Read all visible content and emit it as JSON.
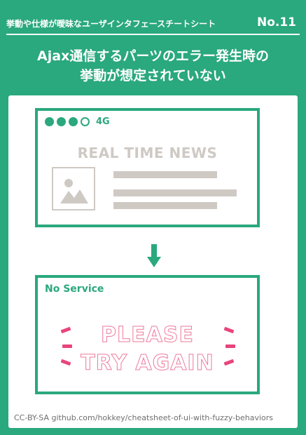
{
  "header": {
    "series": "挙動や仕様が曖昧なユーザインタフェースチートシート",
    "number": "No.11"
  },
  "title": {
    "line1": "Ajax通信するパーツのエラー発生時の",
    "line2": "挙動が想定されていない"
  },
  "before_panel": {
    "signal_bars_filled": 3,
    "signal_bars_total": 4,
    "network": "4G",
    "news_title": "REAL TIME NEWS",
    "thumbnail_icon": "image-placeholder-icon"
  },
  "arrow_icon": "arrow-down-icon",
  "after_panel": {
    "status": "No Service",
    "message_line1": "PLEASE",
    "message_line2": "TRY AGAIN"
  },
  "credit": "CC-BY-SA github.com/hokkey/cheatsheet-of-ui-with-fuzzy-behaviors",
  "colors": {
    "brand_green": "#2aa87e",
    "placeholder_gray": "#cfc9c4",
    "alert_pink": "#e8457b"
  }
}
